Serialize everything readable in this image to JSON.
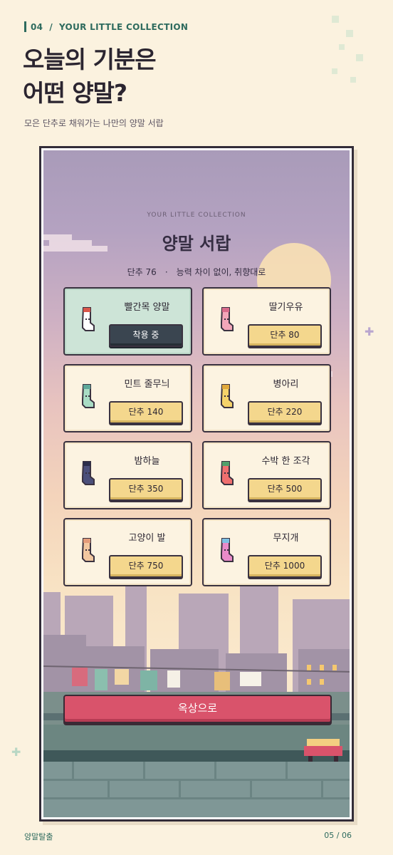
{
  "header": {
    "number": "04",
    "separator": "/",
    "section": "YOUR LITTLE COLLECTION",
    "title_line1": "오늘의 기분은",
    "title_line2": "어떤 양말?",
    "subtitle": "모은 단추로 채워가는 나만의 양말 서랍"
  },
  "screen": {
    "kicker": "YOUR LITTLE COLLECTION",
    "title": "양말 서랍",
    "buttons_count": "단추 76",
    "dot": "·",
    "note": "능력 차이 없이, 취향대로",
    "items": [
      {
        "name": "빨간목 양말",
        "button": "착용 중",
        "equipped": true,
        "colors": [
          "#ffffff",
          "#d9564a"
        ]
      },
      {
        "name": "딸기우유",
        "button": "단추 80",
        "equipped": false,
        "colors": [
          "#f3a6b9",
          "#d96b8b"
        ]
      },
      {
        "name": "민트 줄무늬",
        "button": "단추 140",
        "equipped": false,
        "colors": [
          "#a9dcc4",
          "#5fa89a"
        ]
      },
      {
        "name": "병아리",
        "button": "단추 220",
        "equipped": false,
        "colors": [
          "#f5d36a",
          "#e0a83c"
        ]
      },
      {
        "name": "밤하늘",
        "button": "단추 350",
        "equipped": false,
        "colors": [
          "#4b4f7a",
          "#2b2d4a"
        ]
      },
      {
        "name": "수박 한 조각",
        "button": "단추 500",
        "equipped": false,
        "colors": [
          "#ef6f6f",
          "#4fa06a"
        ]
      },
      {
        "name": "고양이 발",
        "button": "단추 750",
        "equipped": false,
        "colors": [
          "#f2c7a0",
          "#e39b7a"
        ]
      },
      {
        "name": "무지개",
        "button": "단추 1000",
        "equipped": false,
        "colors": [
          "#e98ac9",
          "#7ec0e3"
        ]
      }
    ],
    "rooftop_button": "옥상으로"
  },
  "footer": {
    "left": "양말탈출",
    "right": "05 / 06"
  },
  "colors": {
    "accent": "#2e6b5e",
    "background": "#fbf2df",
    "primary_button": "#d9536b",
    "price_button": "#f4d78d",
    "equipped_button": "#3a4550"
  }
}
